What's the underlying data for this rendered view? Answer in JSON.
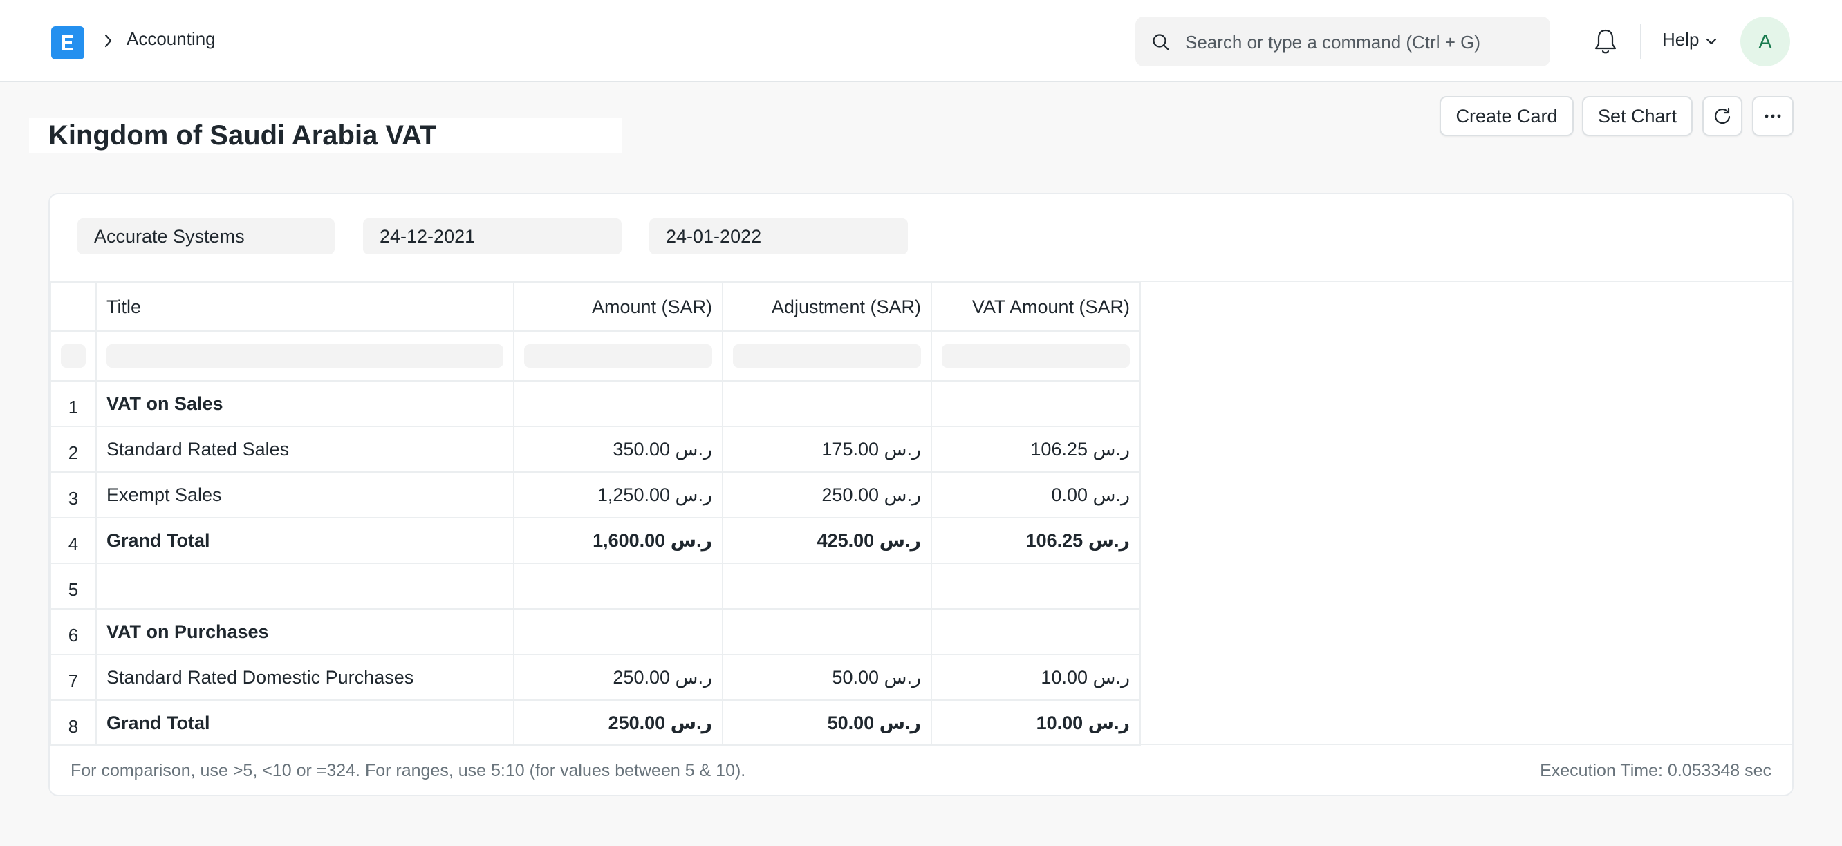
{
  "navbar": {
    "breadcrumb": "Accounting",
    "search_placeholder": "Search or type a command (Ctrl + G)",
    "help_label": "Help",
    "avatar_initial": "A"
  },
  "page": {
    "title": "Kingdom of Saudi Arabia VAT",
    "buttons": {
      "create_card": "Create Card",
      "set_chart": "Set Chart"
    }
  },
  "filters": {
    "company": "Accurate Systems",
    "from_date": "24-12-2021",
    "to_date": "24-01-2022"
  },
  "table": {
    "columns": [
      "Title",
      "Amount (SAR)",
      "Adjustment (SAR)",
      "VAT Amount (SAR)"
    ],
    "rows": [
      {
        "num": "1",
        "title": "VAT on Sales",
        "amount": "",
        "adjustment": "",
        "vat": ""
      },
      {
        "num": "2",
        "title": "Standard Rated Sales",
        "amount": "350.00 ر.س",
        "adjustment": "175.00 ر.س",
        "vat": "106.25 ر.س"
      },
      {
        "num": "3",
        "title": "Exempt Sales",
        "amount": "1,250.00 ر.س",
        "adjustment": "250.00 ر.س",
        "vat": "0.00 ر.س"
      },
      {
        "num": "4",
        "title": "Grand Total",
        "amount": "1,600.00 ر.س",
        "adjustment": "425.00 ر.س",
        "vat": "106.25 ر.س"
      },
      {
        "num": "5",
        "title": "",
        "amount": "",
        "adjustment": "",
        "vat": ""
      },
      {
        "num": "6",
        "title": "VAT on Purchases",
        "amount": "",
        "adjustment": "",
        "vat": ""
      },
      {
        "num": "7",
        "title": "Standard Rated Domestic Purchases",
        "amount": "250.00 ر.س",
        "adjustment": "50.00 ر.س",
        "vat": "10.00 ر.س"
      },
      {
        "num": "8",
        "title": "Grand Total",
        "amount": "250.00 ر.س",
        "adjustment": "50.00 ر.س",
        "vat": "10.00 ر.س"
      }
    ]
  },
  "footer": {
    "note": "For comparison, use >5, <10 or =324. For ranges, use 5:10 (for values between 5 & 10).",
    "execution_time": "Execution Time: 0.053348 sec"
  }
}
